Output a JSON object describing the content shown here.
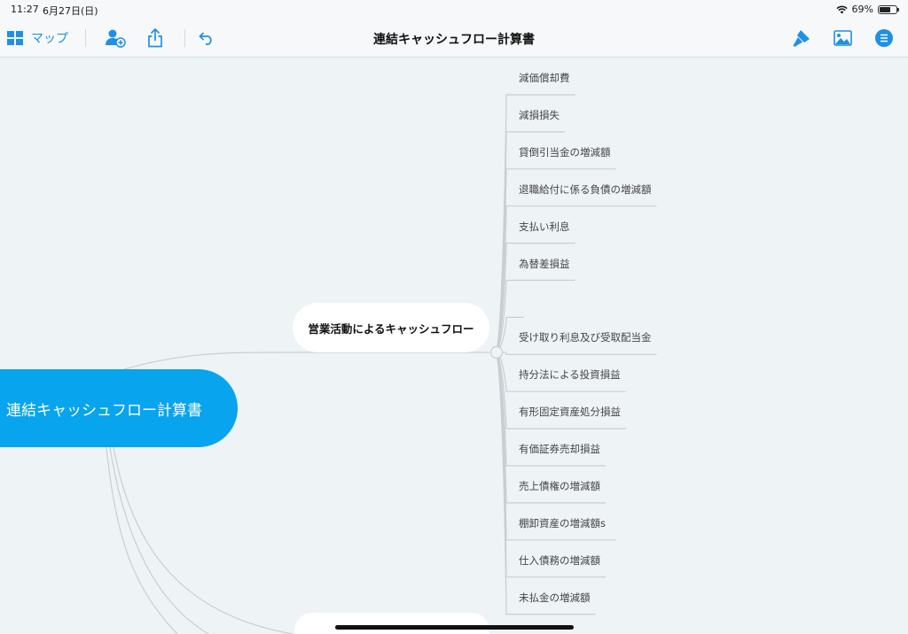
{
  "status": {
    "time": "11:27",
    "date": "6月27日(日)",
    "battery_pct": "69%",
    "battery_level": 0.69
  },
  "toolbar": {
    "map_label": "マップ",
    "title": "連結キャッシュフロー計算書"
  },
  "mindmap": {
    "root": "連結キャッシュフロー計算書",
    "branch": "営業活動によるキャッシュフロー",
    "leaves": [
      "減価償却費",
      "減損損失",
      "貸倒引当金の増減額",
      "退職給付に係る負債の増減額",
      "支払い利息",
      "為替差損益",
      "",
      "受け取り利息及び受取配当金",
      "持分法による投資損益",
      "有形固定資産処分損益",
      "有価証券売却損益",
      "売上債権の増減額",
      "棚卸資産の増減額s",
      "仕入債務の増減額",
      "未払金の増減額"
    ]
  },
  "colors": {
    "accent": "#1e90e6",
    "root": "#08a4ee",
    "background": "#eef3f6",
    "line": "#c9ced3"
  },
  "icons": [
    "grid-icon",
    "add-person-icon",
    "share-icon",
    "undo-icon",
    "format-brush-icon",
    "image-icon",
    "list-menu-icon"
  ]
}
